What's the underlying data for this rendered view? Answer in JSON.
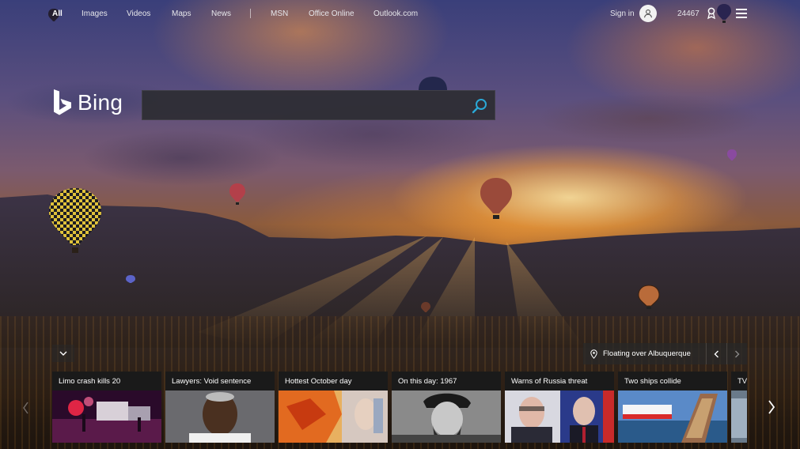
{
  "nav": {
    "links": [
      "All",
      "Images",
      "Videos",
      "Maps",
      "News"
    ],
    "external": [
      "MSN",
      "Office Online",
      "Outlook.com"
    ],
    "sign_in": "Sign in",
    "points": "24467"
  },
  "brand": {
    "name": "Bing"
  },
  "search": {
    "value": "",
    "placeholder": ""
  },
  "icons": {
    "search": "search-icon",
    "user": "user-icon",
    "rewards": "rewards-icon",
    "menu": "hamburger-menu-icon",
    "collapse": "chevron-down-icon",
    "location": "location-pin-icon"
  },
  "image_info": {
    "caption": "Floating over Albuquerque"
  },
  "news": [
    {
      "title": "Limo crash kills 20"
    },
    {
      "title": "Lawyers: Void sentence"
    },
    {
      "title": "Hottest October day"
    },
    {
      "title": "On this day: 1967"
    },
    {
      "title": "Warns of Russia threat"
    },
    {
      "title": "Two ships collide"
    },
    {
      "title": "TV"
    }
  ],
  "colors": {
    "accent": "#2aa8d6",
    "panel": "#1a1a1a"
  }
}
